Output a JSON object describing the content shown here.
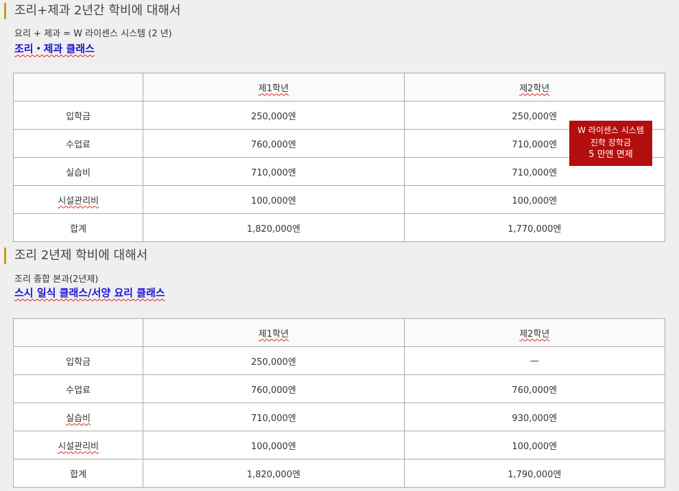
{
  "section1": {
    "heading": "조리+제과 2년간 학비에 대해서",
    "subtitle": "요리 + 제과 = W 라이센스 시스템 (2 년)",
    "course": "조리・제과 클래스",
    "table": {
      "headers": [
        "",
        "제1학년",
        "제2학년"
      ],
      "rows": [
        {
          "label": "입학금",
          "y1": "250,000엔",
          "y2": "250,000엔"
        },
        {
          "label": "수업료",
          "y1": "760,000엔",
          "y2": "710,000엔"
        },
        {
          "label": "실습비",
          "y1": "710,000엔",
          "y2": "710,000엔"
        },
        {
          "label": "시설관리비",
          "y1": "100,000엔",
          "y2": "100,000엔"
        },
        {
          "label": "합계",
          "y1": "1,820,000엔",
          "y2": "1,770,000엔"
        }
      ]
    },
    "badge": {
      "line1": "W 라이센스 시스템",
      "line2": "진학 장학금",
      "line3": "5 만엔 면제"
    }
  },
  "section2": {
    "heading": "조리 2년제 학비에 대해서",
    "subtitle": "조리 종합 본과(2년제)",
    "course": "스시 일식 클래스/서양 요리 클래스",
    "table": {
      "headers": [
        "",
        "제1학년",
        "제2학년"
      ],
      "rows": [
        {
          "label": "입학금",
          "y1": "250,000엔",
          "y2": "—"
        },
        {
          "label": "수업료",
          "y1": "760,000엔",
          "y2": "760,000엔"
        },
        {
          "label": "실습비",
          "y1": "710,000엔",
          "y2": "930,000엔"
        },
        {
          "label": "시설관리비",
          "y1": "100,000엔",
          "y2": "100,000엔"
        },
        {
          "label": "합계",
          "y1": "1,820,000엔",
          "y2": "1,790,000엔"
        }
      ]
    }
  },
  "colors": {
    "accent_bar": "#c89b1c",
    "course_link": "#1a14d4",
    "badge": "#b40f0f"
  }
}
